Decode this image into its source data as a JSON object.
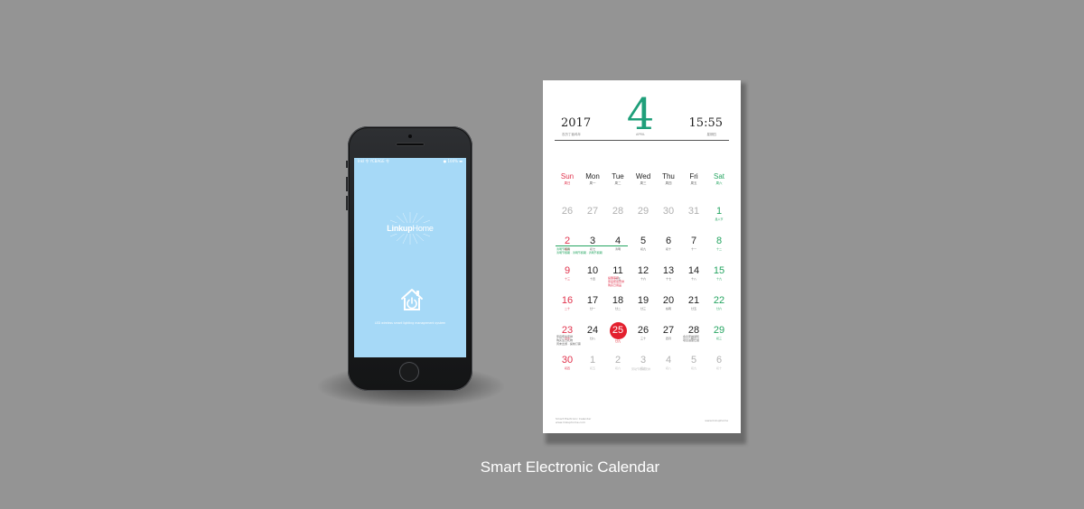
{
  "phone": {
    "status_left": "lnkl 令 YCBAGE 令",
    "status_right": "● 100% ▬",
    "logo_bold": "Linkup",
    "logo_light": "Home",
    "tagline": "LED wireless smart lighting management system"
  },
  "calendar": {
    "year": "2017",
    "year_sub": "农历丁酉鸡年",
    "month": "4",
    "month_sub": "APRIL",
    "time": "15:55",
    "time_sub": "星期四",
    "weekdays": [
      {
        "en": "Sun",
        "zh": "周日"
      },
      {
        "en": "Mon",
        "zh": "周一"
      },
      {
        "en": "Tue",
        "zh": "周二"
      },
      {
        "en": "Wed",
        "zh": "周三"
      },
      {
        "en": "Thu",
        "zh": "周四"
      },
      {
        "en": "Fri",
        "zh": "周五"
      },
      {
        "en": "Sat",
        "zh": "周六"
      }
    ],
    "weeks": [
      [
        {
          "n": "26",
          "s": ""
        },
        {
          "n": "27",
          "s": ""
        },
        {
          "n": "28",
          "s": ""
        },
        {
          "n": "29",
          "s": ""
        },
        {
          "n": "30",
          "s": ""
        },
        {
          "n": "31",
          "s": ""
        },
        {
          "n": "1",
          "s": "愚人节"
        }
      ],
      [
        {
          "n": "2",
          "s": "初六"
        },
        {
          "n": "3",
          "s": "初七"
        },
        {
          "n": "4",
          "s": "清明"
        },
        {
          "n": "5",
          "s": "初九"
        },
        {
          "n": "6",
          "s": "初十"
        },
        {
          "n": "7",
          "s": "十一"
        },
        {
          "n": "8",
          "s": "十二"
        }
      ],
      [
        {
          "n": "9",
          "s": "十三"
        },
        {
          "n": "10",
          "s": "十四"
        },
        {
          "n": "11",
          "s": "十五"
        },
        {
          "n": "12",
          "s": "十六"
        },
        {
          "n": "13",
          "s": "十七"
        },
        {
          "n": "14",
          "s": "十八"
        },
        {
          "n": "15",
          "s": "十九"
        }
      ],
      [
        {
          "n": "16",
          "s": "二十"
        },
        {
          "n": "17",
          "s": "廿一"
        },
        {
          "n": "18",
          "s": "廿二"
        },
        {
          "n": "19",
          "s": "廿三"
        },
        {
          "n": "20",
          "s": "谷雨"
        },
        {
          "n": "21",
          "s": "廿五"
        },
        {
          "n": "22",
          "s": "廿六"
        }
      ],
      [
        {
          "n": "23",
          "s": "廿七"
        },
        {
          "n": "24",
          "s": "廿八"
        },
        {
          "n": "25",
          "s": "廿九"
        },
        {
          "n": "26",
          "s": "三十"
        },
        {
          "n": "27",
          "s": "四月"
        },
        {
          "n": "28",
          "s": "初二"
        },
        {
          "n": "29",
          "s": "初三"
        }
      ],
      [
        {
          "n": "30",
          "s": "初四"
        },
        {
          "n": "1",
          "s": "初五"
        },
        {
          "n": "2",
          "s": "初六"
        },
        {
          "n": "3",
          "s": "初七"
        },
        {
          "n": "4",
          "s": "初八"
        },
        {
          "n": "5",
          "s": "初九"
        },
        {
          "n": "6",
          "s": "初十"
        }
      ]
    ],
    "notes": {
      "apr2_a": "清明节假期",
      "apr2_b": "清明节假期 · 清明节假期 · 清明节假期",
      "apr11_a": "提醒事项",
      "apr11_b": "家庭聚会安排",
      "apr11_c": "购买日用品",
      "apr23_a": "家庭聚会安排",
      "apr23_b": "购买生日礼物",
      "apr23_c": "周末出游 · 提前订票",
      "apr28_a": "会议安排通知",
      "apr28_b": "项目进度汇报",
      "may3": "劳动节假期安排"
    },
    "footer_left_1": "Smart Electronic Calendar",
    "footer_left_2": "www.linkuphome.com",
    "footer_right": "www.linkuphome"
  },
  "caption": "Smart Electronic Calendar"
}
